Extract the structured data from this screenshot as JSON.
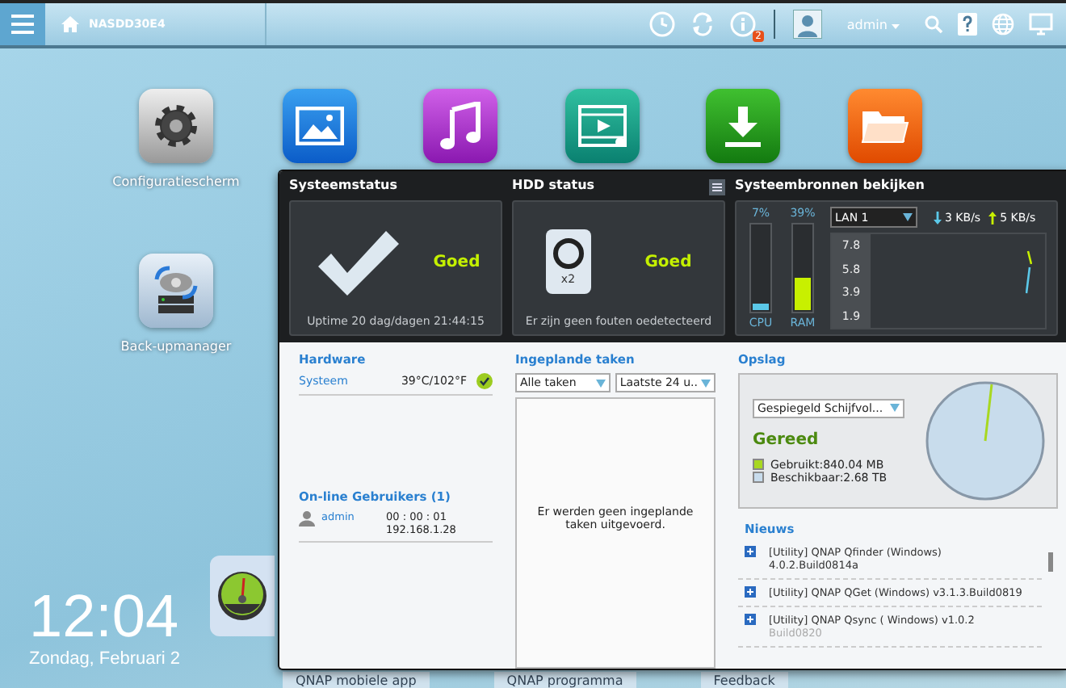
{
  "topbar": {
    "title": "NASDD30E4",
    "notification_count": "2",
    "user": "admin"
  },
  "desktop_icons": [
    {
      "kind": "settings",
      "label": "Configuratiescherm"
    },
    {
      "kind": "photo"
    },
    {
      "kind": "music"
    },
    {
      "kind": "video"
    },
    {
      "kind": "download"
    },
    {
      "kind": "folder"
    },
    {
      "kind": "backup",
      "label": "Back-upmanager"
    }
  ],
  "clock": {
    "time": "12:04",
    "date": "Zondag, Februari 2"
  },
  "dashboard": {
    "system_status": {
      "title": "Systeemstatus",
      "status": "Goed",
      "uptime": "Uptime 20 dag/dagen 21:44:15"
    },
    "hdd_status": {
      "title": "HDD status",
      "count": "x2",
      "status": "Goed",
      "message": "Er zijn geen fouten oedetecteerd"
    },
    "resources": {
      "title": "Systeembronnen bekijken",
      "meters": [
        {
          "label": "CPU",
          "reading": "7%",
          "level": 0.07,
          "color": "#5bc8e8"
        },
        {
          "label": "RAM",
          "reading": "39%",
          "level": 0.39,
          "color": "#c8f000"
        }
      ],
      "interface": "LAN 1",
      "download": "3 KB/s",
      "upload": "5 KB/s",
      "axis_labels": [
        "7.8",
        "5.8",
        "3.9",
        "1.9"
      ]
    },
    "hardware": {
      "title": "Hardware",
      "rows": [
        {
          "label": "Systeem",
          "value": "39°C/102°F"
        }
      ]
    },
    "online_users": {
      "title": "On-line Gebruikers (1)",
      "users": [
        {
          "name": "admin",
          "duration": "00 : 00 : 01",
          "ip": "192.168.1.28"
        }
      ]
    },
    "scheduled_tasks": {
      "title": "Ingeplande taken",
      "filters": [
        "Alle taken",
        "Laatste 24 u.."
      ],
      "message": "Er werden geen ingeplande taken uitgevoerd."
    },
    "storage": {
      "title": "Opslag",
      "volume": "Gespiegeld Schijfvol...",
      "status": "Gereed",
      "legend": [
        {
          "label": "Gebruikt:840.04 MB",
          "color": "#a8d820"
        },
        {
          "label": "Beschikbaar:2.68 TB",
          "color": "#c8dcec"
        }
      ]
    },
    "news": {
      "title": "Nieuws",
      "items": [
        {
          "lines": [
            "[Utility] QNAP Qfinder (Windows)",
            "4.0.2.Build0814a"
          ]
        },
        {
          "lines": [
            "[Utility] QNAP QGet (Windows) v3.1.3.Build0819"
          ]
        },
        {
          "lines": [
            "[Utility] QNAP Qsync ( Windows) v1.0.2",
            "Build0820"
          ]
        }
      ]
    }
  },
  "taskbar": [
    "QNAP mobiele app",
    "QNAP programma",
    "Feedback"
  ]
}
